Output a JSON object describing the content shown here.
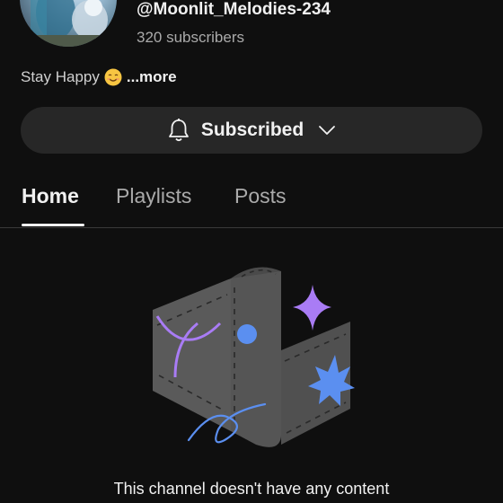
{
  "channel": {
    "handle": "@Moonlit_Melodies-234",
    "subscribers": "320 subscribers",
    "bio_text": "Stay Happy",
    "bio_more": "...more"
  },
  "subscribe": {
    "label": "Subscribed"
  },
  "tabs": [
    {
      "label": "Home",
      "active": true
    },
    {
      "label": "Playlists",
      "active": false
    },
    {
      "label": "Posts",
      "active": false
    }
  ],
  "empty_state": {
    "message": "This channel doesn't have any content"
  },
  "colors": {
    "background": "#0f0f0f",
    "button_bg": "#272727",
    "secondary_text": "#aaaaaa",
    "purple_accent": "#a97cf5",
    "blue_accent": "#5b8ff0"
  },
  "icons": {
    "bio_emoji": "smiling-face-emoji",
    "subscribe_icon": "bell-icon",
    "subscribe_chevron": "chevron-down-icon"
  }
}
